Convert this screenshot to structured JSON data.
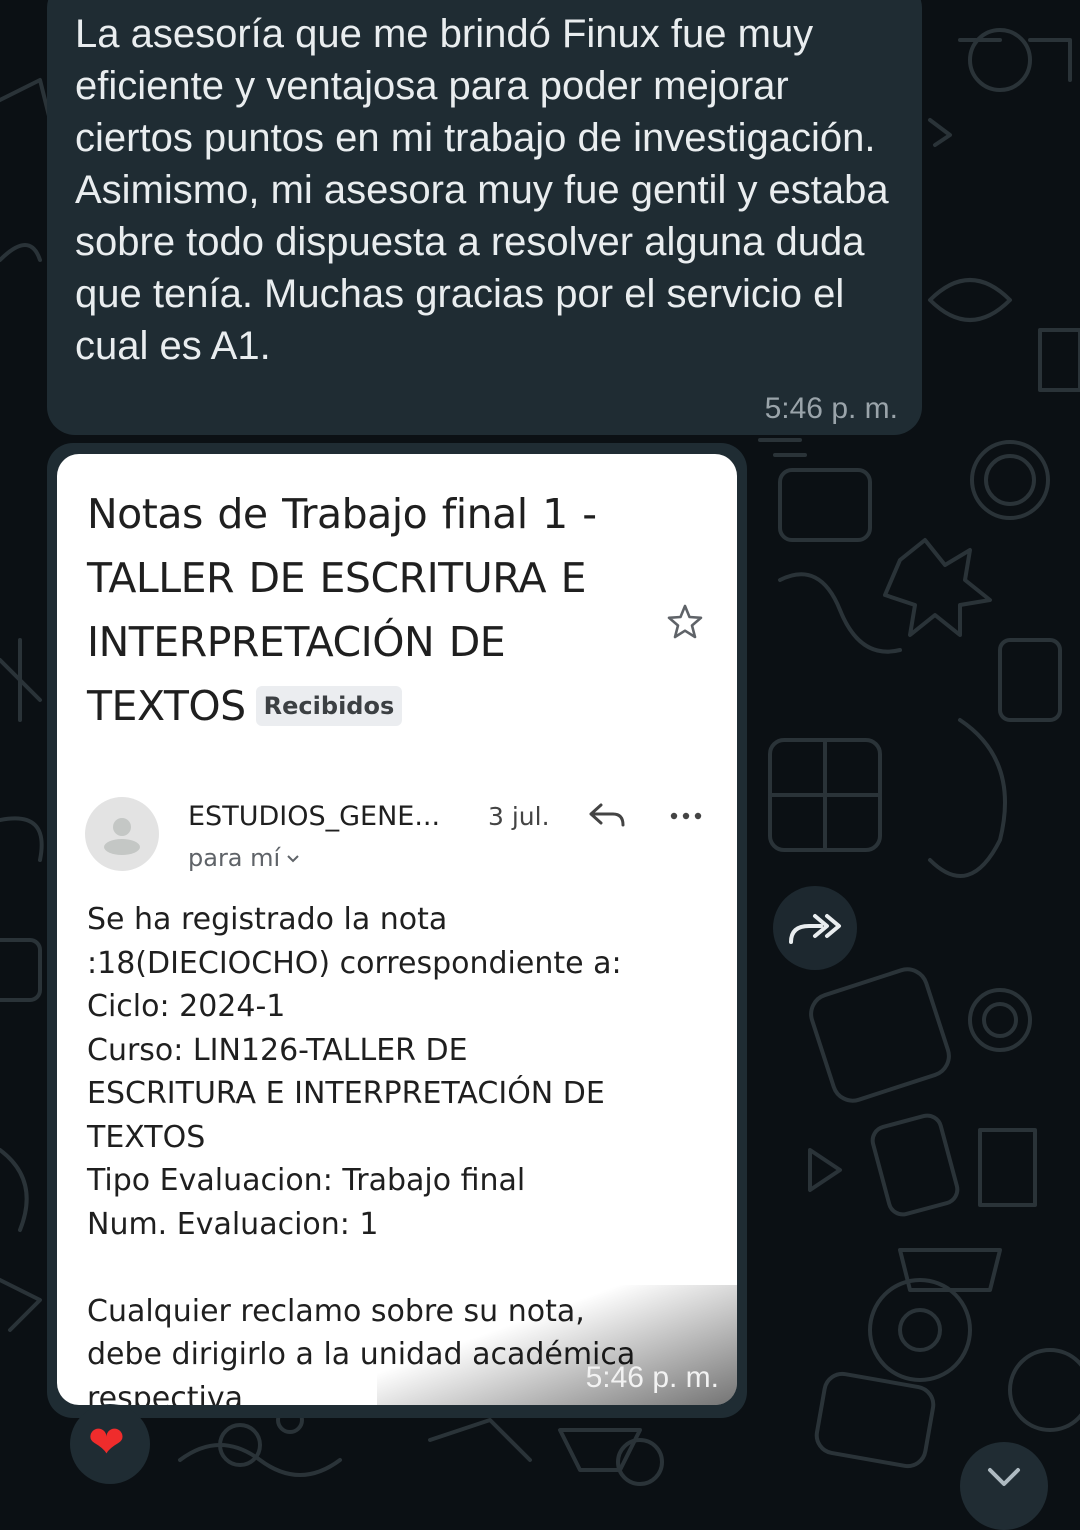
{
  "chat": {
    "incoming_message": {
      "text": "La asesoría que me brindó Finux fue muy eficiente y ventajosa para poder mejorar ciertos puntos en mi trabajo de investigación. Asimismo, mi asesora muy fue gentil y estaba sobre todo dispuesta a resolver alguna duda que tenía. Muchas gracias por el servicio el cual es A1.",
      "time": "5:46 p. m."
    },
    "image_message": {
      "time": "5:46 p. m.",
      "reaction": "❤"
    }
  },
  "email": {
    "subject": "Notas de Trabajo final 1 - TALLER DE ESCRITURA E INTERPRETACIÓN DE TEXTOS",
    "label": "Recibidos",
    "sender": "ESTUDIOS_GENE...",
    "date": "3 jul.",
    "recipient": "para mí",
    "body_lines": [
      "Se ha registrado la nota",
      ":18(DIECIOCHO) correspondiente a:",
      "Ciclo: 2024-1",
      "Curso: LIN126-TALLER DE",
      "ESCRITURA E INTERPRETACIÓN DE",
      "TEXTOS",
      "Tipo Evaluacion: Trabajo final",
      "Num. Evaluacion: 1",
      "",
      "Cualquier reclamo sobre su nota,",
      "debe dirigirlo a la unidad académica",
      "respectiva"
    ]
  },
  "icons": {
    "star": "star-outline-icon",
    "reply": "reply-icon",
    "more": "more-horizontal-icon",
    "forward": "forward-icon",
    "scroll_down": "chevron-down-icon",
    "avatar": "person-avatar-icon"
  },
  "colors": {
    "background": "#0b1014",
    "bubble": "#1f2c33",
    "text": "#e9edef",
    "timestamp": "#9aa4aa",
    "reaction_heart": "#ef2c2c"
  }
}
